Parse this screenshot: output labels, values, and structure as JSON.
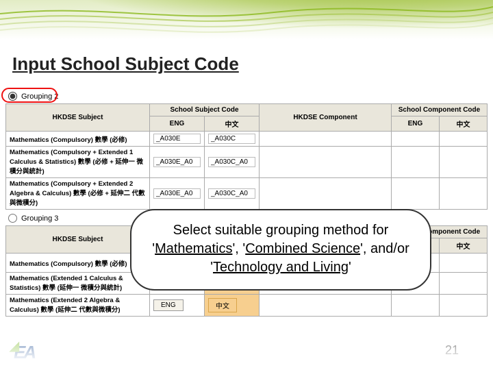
{
  "page_title": "Input School Subject Code",
  "grouping2_label": "Grouping 2",
  "grouping3_label": "Grouping 3",
  "headers": {
    "hkdse_subject": "HKDSE Subject",
    "school_subject_code": "School Subject Code",
    "hkdse_component": "HKDSE Component",
    "school_component_code": "School Component Code",
    "eng": "ENG",
    "zh": "中文"
  },
  "table2_rows": [
    {
      "subject": "Mathematics (Compulsory) 數學 (必修)",
      "eng": "_A030E",
      "zh": "_A030C"
    },
    {
      "subject": "Mathematics (Compulsory + Extended 1 Calculus & Statistics) 數學 (必修 + 延伸一 微積分與統計)",
      "eng": "_A030E_A0",
      "zh": "_A030C_A0"
    },
    {
      "subject": "Mathematics (Compulsory + Extended 2 Algebra & Calculus) 數學 (必修 + 延伸二 代數與微積分)",
      "eng": "_A030E_A0",
      "zh": "_A030C_A0"
    }
  ],
  "table3_rows": [
    {
      "subject": "Mathematics (Compulsory) 數學 (必修)"
    },
    {
      "subject": "Mathematics (Extended 1 Calculus & Statistics) 數學 (延伸一 微積分與統計)"
    },
    {
      "subject": "Mathematics (Extended 2 Algebra & Calculus) 數學 (延伸二 代數與微積分)"
    }
  ],
  "callout": {
    "part1": "Select suitable grouping method for '",
    "sub1": "Mathematics",
    "mid1": "', '",
    "sub2": "Combined Science",
    "mid2": "', and/or '",
    "sub3": "Technology and Living",
    "end": "'"
  },
  "page_number": "21"
}
